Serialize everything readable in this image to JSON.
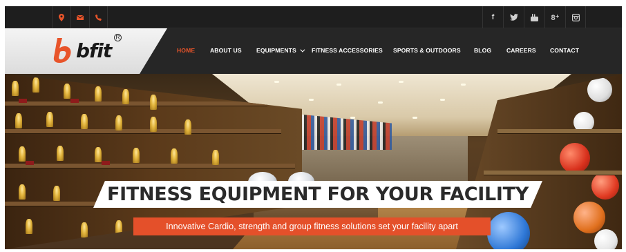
{
  "brand": {
    "logo_text": "bfit",
    "registered_mark": "R",
    "accent_color": "#e8542a"
  },
  "topbar": {
    "contact_icons": [
      "location-icon",
      "mail-icon",
      "phone-icon"
    ],
    "social_icons": [
      "facebook-icon",
      "twitter-icon",
      "youtube-icon",
      "google-plus-icon",
      "instagram-icon"
    ],
    "social_glyphs": {
      "facebook": "f",
      "google_plus": "8⁺"
    }
  },
  "nav": {
    "items": [
      {
        "label": "HOME",
        "active": true
      },
      {
        "label": "ABOUT US",
        "active": false
      },
      {
        "label": "EQUIPMENTS",
        "active": false,
        "has_dropdown": true
      },
      {
        "label": "FITNESS ACCESSORIES",
        "active": false
      },
      {
        "label": "SPORTS & OUTDOORS",
        "active": false
      },
      {
        "label": "BLOG",
        "active": false
      },
      {
        "label": "CAREERS",
        "active": false
      },
      {
        "label": "CONTACT",
        "active": false
      }
    ]
  },
  "hero": {
    "headline": "FITNESS EQUIPMENT FOR YOUR FACILITY",
    "subheadline": "Innovative Cardio, strength and group fitness solutions set your facility apart",
    "subheadline_bg": "#e4502a"
  }
}
